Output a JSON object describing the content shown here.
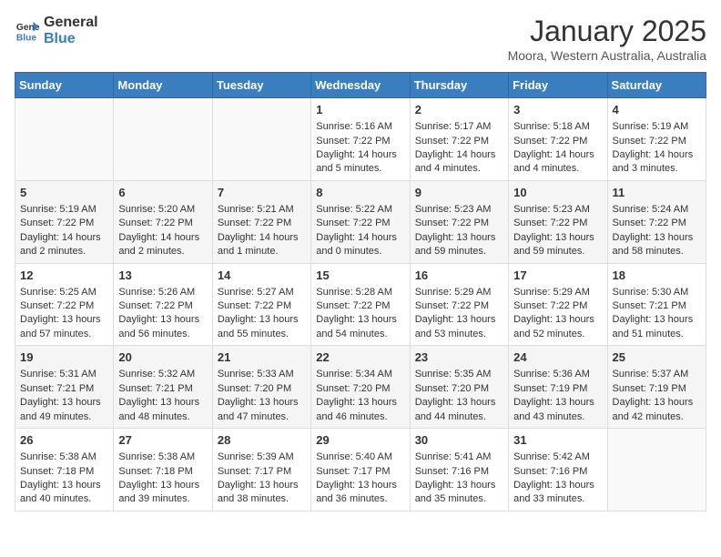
{
  "header": {
    "logo": {
      "text_general": "General",
      "text_blue": "Blue"
    },
    "title": "January 2025",
    "subtitle": "Moora, Western Australia, Australia"
  },
  "weekdays": [
    "Sunday",
    "Monday",
    "Tuesday",
    "Wednesday",
    "Thursday",
    "Friday",
    "Saturday"
  ],
  "weeks": [
    [
      {
        "day": "",
        "sunrise": "",
        "sunset": "",
        "daylight": ""
      },
      {
        "day": "",
        "sunrise": "",
        "sunset": "",
        "daylight": ""
      },
      {
        "day": "",
        "sunrise": "",
        "sunset": "",
        "daylight": ""
      },
      {
        "day": "1",
        "sunrise": "Sunrise: 5:16 AM",
        "sunset": "Sunset: 7:22 PM",
        "daylight": "Daylight: 14 hours and 5 minutes."
      },
      {
        "day": "2",
        "sunrise": "Sunrise: 5:17 AM",
        "sunset": "Sunset: 7:22 PM",
        "daylight": "Daylight: 14 hours and 4 minutes."
      },
      {
        "day": "3",
        "sunrise": "Sunrise: 5:18 AM",
        "sunset": "Sunset: 7:22 PM",
        "daylight": "Daylight: 14 hours and 4 minutes."
      },
      {
        "day": "4",
        "sunrise": "Sunrise: 5:19 AM",
        "sunset": "Sunset: 7:22 PM",
        "daylight": "Daylight: 14 hours and 3 minutes."
      }
    ],
    [
      {
        "day": "5",
        "sunrise": "Sunrise: 5:19 AM",
        "sunset": "Sunset: 7:22 PM",
        "daylight": "Daylight: 14 hours and 2 minutes."
      },
      {
        "day": "6",
        "sunrise": "Sunrise: 5:20 AM",
        "sunset": "Sunset: 7:22 PM",
        "daylight": "Daylight: 14 hours and 2 minutes."
      },
      {
        "day": "7",
        "sunrise": "Sunrise: 5:21 AM",
        "sunset": "Sunset: 7:22 PM",
        "daylight": "Daylight: 14 hours and 1 minute."
      },
      {
        "day": "8",
        "sunrise": "Sunrise: 5:22 AM",
        "sunset": "Sunset: 7:22 PM",
        "daylight": "Daylight: 14 hours and 0 minutes."
      },
      {
        "day": "9",
        "sunrise": "Sunrise: 5:23 AM",
        "sunset": "Sunset: 7:22 PM",
        "daylight": "Daylight: 13 hours and 59 minutes."
      },
      {
        "day": "10",
        "sunrise": "Sunrise: 5:23 AM",
        "sunset": "Sunset: 7:22 PM",
        "daylight": "Daylight: 13 hours and 59 minutes."
      },
      {
        "day": "11",
        "sunrise": "Sunrise: 5:24 AM",
        "sunset": "Sunset: 7:22 PM",
        "daylight": "Daylight: 13 hours and 58 minutes."
      }
    ],
    [
      {
        "day": "12",
        "sunrise": "Sunrise: 5:25 AM",
        "sunset": "Sunset: 7:22 PM",
        "daylight": "Daylight: 13 hours and 57 minutes."
      },
      {
        "day": "13",
        "sunrise": "Sunrise: 5:26 AM",
        "sunset": "Sunset: 7:22 PM",
        "daylight": "Daylight: 13 hours and 56 minutes."
      },
      {
        "day": "14",
        "sunrise": "Sunrise: 5:27 AM",
        "sunset": "Sunset: 7:22 PM",
        "daylight": "Daylight: 13 hours and 55 minutes."
      },
      {
        "day": "15",
        "sunrise": "Sunrise: 5:28 AM",
        "sunset": "Sunset: 7:22 PM",
        "daylight": "Daylight: 13 hours and 54 minutes."
      },
      {
        "day": "16",
        "sunrise": "Sunrise: 5:29 AM",
        "sunset": "Sunset: 7:22 PM",
        "daylight": "Daylight: 13 hours and 53 minutes."
      },
      {
        "day": "17",
        "sunrise": "Sunrise: 5:29 AM",
        "sunset": "Sunset: 7:22 PM",
        "daylight": "Daylight: 13 hours and 52 minutes."
      },
      {
        "day": "18",
        "sunrise": "Sunrise: 5:30 AM",
        "sunset": "Sunset: 7:21 PM",
        "daylight": "Daylight: 13 hours and 51 minutes."
      }
    ],
    [
      {
        "day": "19",
        "sunrise": "Sunrise: 5:31 AM",
        "sunset": "Sunset: 7:21 PM",
        "daylight": "Daylight: 13 hours and 49 minutes."
      },
      {
        "day": "20",
        "sunrise": "Sunrise: 5:32 AM",
        "sunset": "Sunset: 7:21 PM",
        "daylight": "Daylight: 13 hours and 48 minutes."
      },
      {
        "day": "21",
        "sunrise": "Sunrise: 5:33 AM",
        "sunset": "Sunset: 7:20 PM",
        "daylight": "Daylight: 13 hours and 47 minutes."
      },
      {
        "day": "22",
        "sunrise": "Sunrise: 5:34 AM",
        "sunset": "Sunset: 7:20 PM",
        "daylight": "Daylight: 13 hours and 46 minutes."
      },
      {
        "day": "23",
        "sunrise": "Sunrise: 5:35 AM",
        "sunset": "Sunset: 7:20 PM",
        "daylight": "Daylight: 13 hours and 44 minutes."
      },
      {
        "day": "24",
        "sunrise": "Sunrise: 5:36 AM",
        "sunset": "Sunset: 7:19 PM",
        "daylight": "Daylight: 13 hours and 43 minutes."
      },
      {
        "day": "25",
        "sunrise": "Sunrise: 5:37 AM",
        "sunset": "Sunset: 7:19 PM",
        "daylight": "Daylight: 13 hours and 42 minutes."
      }
    ],
    [
      {
        "day": "26",
        "sunrise": "Sunrise: 5:38 AM",
        "sunset": "Sunset: 7:18 PM",
        "daylight": "Daylight: 13 hours and 40 minutes."
      },
      {
        "day": "27",
        "sunrise": "Sunrise: 5:38 AM",
        "sunset": "Sunset: 7:18 PM",
        "daylight": "Daylight: 13 hours and 39 minutes."
      },
      {
        "day": "28",
        "sunrise": "Sunrise: 5:39 AM",
        "sunset": "Sunset: 7:17 PM",
        "daylight": "Daylight: 13 hours and 38 minutes."
      },
      {
        "day": "29",
        "sunrise": "Sunrise: 5:40 AM",
        "sunset": "Sunset: 7:17 PM",
        "daylight": "Daylight: 13 hours and 36 minutes."
      },
      {
        "day": "30",
        "sunrise": "Sunrise: 5:41 AM",
        "sunset": "Sunset: 7:16 PM",
        "daylight": "Daylight: 13 hours and 35 minutes."
      },
      {
        "day": "31",
        "sunrise": "Sunrise: 5:42 AM",
        "sunset": "Sunset: 7:16 PM",
        "daylight": "Daylight: 13 hours and 33 minutes."
      },
      {
        "day": "",
        "sunrise": "",
        "sunset": "",
        "daylight": ""
      }
    ]
  ]
}
